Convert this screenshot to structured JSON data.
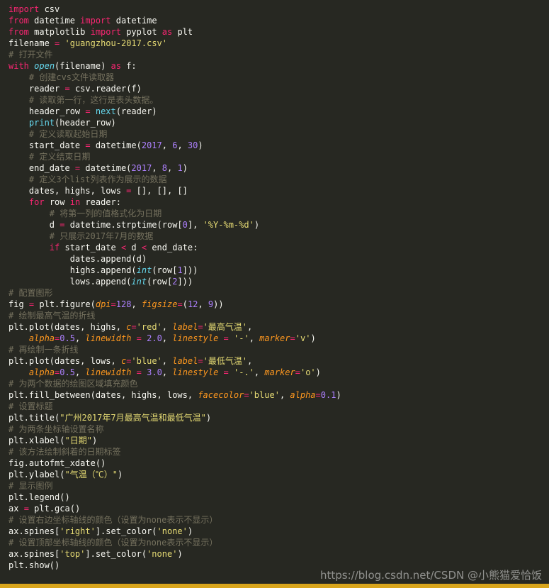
{
  "colors": {
    "background": "#272822",
    "plain": "#f8f8f2",
    "keyword": "#f92672",
    "comment": "#75715e",
    "string": "#e6db74",
    "number": "#ae81ff",
    "builtin": "#66d9ef",
    "param": "#fd971f",
    "bottom_bar": "#d9a51c"
  },
  "watermark": "https://blog.csdn.net/CSDN @小熊猫爱恰饭",
  "code_lines": [
    [
      [
        "kw",
        "import"
      ],
      [
        "tx",
        " csv"
      ]
    ],
    [
      [
        "kw",
        "from"
      ],
      [
        "tx",
        " datetime "
      ],
      [
        "kw",
        "import"
      ],
      [
        "tx",
        " datetime"
      ]
    ],
    [
      [
        "kw",
        "from"
      ],
      [
        "tx",
        " matplotlib "
      ],
      [
        "kw",
        "import"
      ],
      [
        "tx",
        " pyplot "
      ],
      [
        "kw",
        "as"
      ],
      [
        "tx",
        " plt"
      ]
    ],
    [
      [
        "tx",
        "filename "
      ],
      [
        "kw",
        "="
      ],
      [
        "tx",
        " "
      ],
      [
        "st",
        "'guangzhou-2017.csv'"
      ]
    ],
    [
      [
        "cm",
        "# 打开文件"
      ]
    ],
    [
      [
        "kw",
        "with"
      ],
      [
        "tx",
        " "
      ],
      [
        "bi-it",
        "open"
      ],
      [
        "tx",
        "(filename) "
      ],
      [
        "kw",
        "as"
      ],
      [
        "tx",
        " f:"
      ]
    ],
    [
      [
        "tx",
        "    "
      ],
      [
        "cm",
        "# 创建cvs文件读取器"
      ]
    ],
    [
      [
        "tx",
        "    reader "
      ],
      [
        "kw",
        "="
      ],
      [
        "tx",
        " csv.reader(f)"
      ]
    ],
    [
      [
        "tx",
        "    "
      ],
      [
        "cm",
        "# 读取第一行，这行是表头数据。"
      ]
    ],
    [
      [
        "tx",
        "    header_row "
      ],
      [
        "kw",
        "="
      ],
      [
        "tx",
        " "
      ],
      [
        "bi",
        "next"
      ],
      [
        "tx",
        "(reader)"
      ]
    ],
    [
      [
        "tx",
        "    "
      ],
      [
        "bi",
        "print"
      ],
      [
        "tx",
        "(header_row)"
      ]
    ],
    [
      [
        "tx",
        "    "
      ],
      [
        "cm",
        "# 定义读取起始日期"
      ]
    ],
    [
      [
        "tx",
        "    start_date "
      ],
      [
        "kw",
        "="
      ],
      [
        "tx",
        " datetime("
      ],
      [
        "nm",
        "2017"
      ],
      [
        "tx",
        ", "
      ],
      [
        "nm",
        "6"
      ],
      [
        "tx",
        ", "
      ],
      [
        "nm",
        "30"
      ],
      [
        "tx",
        ")"
      ]
    ],
    [
      [
        "tx",
        "    "
      ],
      [
        "cm",
        "# 定义结束日期"
      ]
    ],
    [
      [
        "tx",
        "    end_date "
      ],
      [
        "kw",
        "="
      ],
      [
        "tx",
        " datetime("
      ],
      [
        "nm",
        "2017"
      ],
      [
        "tx",
        ", "
      ],
      [
        "nm",
        "8"
      ],
      [
        "tx",
        ", "
      ],
      [
        "nm",
        "1"
      ],
      [
        "tx",
        ")"
      ]
    ],
    [
      [
        "tx",
        "    "
      ],
      [
        "cm",
        "# 定义3个list列表作为展示的数据"
      ]
    ],
    [
      [
        "tx",
        "    dates, highs, lows "
      ],
      [
        "kw",
        "="
      ],
      [
        "tx",
        " [], [], []"
      ]
    ],
    [
      [
        "tx",
        "    "
      ],
      [
        "kw",
        "for"
      ],
      [
        "tx",
        " row "
      ],
      [
        "kw",
        "in"
      ],
      [
        "tx",
        " reader:"
      ]
    ],
    [
      [
        "tx",
        "        "
      ],
      [
        "cm",
        "# 将第一列的值格式化为日期"
      ]
    ],
    [
      [
        "tx",
        "        d "
      ],
      [
        "kw",
        "="
      ],
      [
        "tx",
        " datetime.strptime(row["
      ],
      [
        "nm",
        "0"
      ],
      [
        "tx",
        "], "
      ],
      [
        "st",
        "'%Y-%m-%d'"
      ],
      [
        "tx",
        ")"
      ]
    ],
    [
      [
        "tx",
        "        "
      ],
      [
        "cm",
        "# 只展示2017年7月的数据"
      ]
    ],
    [
      [
        "tx",
        "        "
      ],
      [
        "kw",
        "if"
      ],
      [
        "tx",
        " start_date "
      ],
      [
        "kw",
        "<"
      ],
      [
        "tx",
        " d "
      ],
      [
        "kw",
        "<"
      ],
      [
        "tx",
        " end_date:"
      ]
    ],
    [
      [
        "tx",
        "            dates.append(d)"
      ]
    ],
    [
      [
        "tx",
        "            highs.append("
      ],
      [
        "bi-it",
        "int"
      ],
      [
        "tx",
        "(row["
      ],
      [
        "nm",
        "1"
      ],
      [
        "tx",
        "]))"
      ]
    ],
    [
      [
        "tx",
        "            lows.append("
      ],
      [
        "bi-it",
        "int"
      ],
      [
        "tx",
        "(row["
      ],
      [
        "nm",
        "2"
      ],
      [
        "tx",
        "]))"
      ]
    ],
    [
      [
        "cm",
        "# 配置图形"
      ]
    ],
    [
      [
        "tx",
        "fig "
      ],
      [
        "kw",
        "="
      ],
      [
        "tx",
        " plt.figure("
      ],
      [
        "pm",
        "dpi"
      ],
      [
        "kw",
        "="
      ],
      [
        "nm",
        "128"
      ],
      [
        "tx",
        ", "
      ],
      [
        "pm",
        "figsize"
      ],
      [
        "kw",
        "="
      ],
      [
        "tx",
        "("
      ],
      [
        "nm",
        "12"
      ],
      [
        "tx",
        ", "
      ],
      [
        "nm",
        "9"
      ],
      [
        "tx",
        "))"
      ]
    ],
    [
      [
        "cm",
        "# 绘制最高气温的折线"
      ]
    ],
    [
      [
        "tx",
        "plt.plot(dates, highs, "
      ],
      [
        "pm",
        "c"
      ],
      [
        "kw",
        "="
      ],
      [
        "st",
        "'red'"
      ],
      [
        "tx",
        ", "
      ],
      [
        "pm",
        "label"
      ],
      [
        "kw",
        "="
      ],
      [
        "st",
        "'最高气温'"
      ],
      [
        "tx",
        ","
      ]
    ],
    [
      [
        "tx",
        "    "
      ],
      [
        "pm",
        "alpha"
      ],
      [
        "kw",
        "="
      ],
      [
        "nm",
        "0.5"
      ],
      [
        "tx",
        ", "
      ],
      [
        "pm",
        "linewidth"
      ],
      [
        "tx",
        " "
      ],
      [
        "kw",
        "="
      ],
      [
        "tx",
        " "
      ],
      [
        "nm",
        "2.0"
      ],
      [
        "tx",
        ", "
      ],
      [
        "pm",
        "linestyle"
      ],
      [
        "tx",
        " "
      ],
      [
        "kw",
        "="
      ],
      [
        "tx",
        " "
      ],
      [
        "st",
        "'-'"
      ],
      [
        "tx",
        ", "
      ],
      [
        "pm",
        "marker"
      ],
      [
        "kw",
        "="
      ],
      [
        "st",
        "'v'"
      ],
      [
        "tx",
        ")"
      ]
    ],
    [
      [
        "cm",
        "# 再绘制一条折线"
      ]
    ],
    [
      [
        "tx",
        "plt.plot(dates, lows, "
      ],
      [
        "pm",
        "c"
      ],
      [
        "kw",
        "="
      ],
      [
        "st",
        "'blue'"
      ],
      [
        "tx",
        ", "
      ],
      [
        "pm",
        "label"
      ],
      [
        "kw",
        "="
      ],
      [
        "st",
        "'最低气温'"
      ],
      [
        "tx",
        ","
      ]
    ],
    [
      [
        "tx",
        "    "
      ],
      [
        "pm",
        "alpha"
      ],
      [
        "kw",
        "="
      ],
      [
        "nm",
        "0.5"
      ],
      [
        "tx",
        ", "
      ],
      [
        "pm",
        "linewidth"
      ],
      [
        "tx",
        " "
      ],
      [
        "kw",
        "="
      ],
      [
        "tx",
        " "
      ],
      [
        "nm",
        "3.0"
      ],
      [
        "tx",
        ", "
      ],
      [
        "pm",
        "linestyle"
      ],
      [
        "tx",
        " "
      ],
      [
        "kw",
        "="
      ],
      [
        "tx",
        " "
      ],
      [
        "st",
        "'-.'"
      ],
      [
        "tx",
        ", "
      ],
      [
        "pm",
        "marker"
      ],
      [
        "kw",
        "="
      ],
      [
        "st",
        "'o'"
      ],
      [
        "tx",
        ")"
      ]
    ],
    [
      [
        "cm",
        "# 为两个数据的绘图区域填充颜色"
      ]
    ],
    [
      [
        "tx",
        "plt.fill_between(dates, highs, lows, "
      ],
      [
        "pm",
        "facecolor"
      ],
      [
        "kw",
        "="
      ],
      [
        "st",
        "'blue'"
      ],
      [
        "tx",
        ", "
      ],
      [
        "pm",
        "alpha"
      ],
      [
        "kw",
        "="
      ],
      [
        "nm",
        "0.1"
      ],
      [
        "tx",
        ")"
      ]
    ],
    [
      [
        "cm",
        "# 设置标题"
      ]
    ],
    [
      [
        "tx",
        "plt.title("
      ],
      [
        "st",
        "\"广州2017年7月最高气温和最低气温\""
      ],
      [
        "tx",
        ")"
      ]
    ],
    [
      [
        "cm",
        "# 为两条坐标轴设置名称"
      ]
    ],
    [
      [
        "tx",
        "plt.xlabel("
      ],
      [
        "st",
        "\"日期\""
      ],
      [
        "tx",
        ")"
      ]
    ],
    [
      [
        "cm",
        "# 该方法绘制斜着的日期标签"
      ]
    ],
    [
      [
        "tx",
        "fig.autofmt_xdate()"
      ]
    ],
    [
      [
        "tx",
        "plt.ylabel("
      ],
      [
        "st",
        "\"气温（℃）\""
      ],
      [
        "tx",
        ")"
      ]
    ],
    [
      [
        "cm",
        "# 显示图例"
      ]
    ],
    [
      [
        "tx",
        "plt.legend()"
      ]
    ],
    [
      [
        "tx",
        "ax "
      ],
      [
        "kw",
        "="
      ],
      [
        "tx",
        " plt.gca()"
      ]
    ],
    [
      [
        "cm",
        "# 设置右边坐标轴线的颜色（设置为none表示不显示）"
      ]
    ],
    [
      [
        "tx",
        "ax.spines["
      ],
      [
        "st",
        "'right'"
      ],
      [
        "tx",
        "].set_color("
      ],
      [
        "st",
        "'none'"
      ],
      [
        "tx",
        ")"
      ]
    ],
    [
      [
        "cm",
        "# 设置顶部坐标轴线的颜色（设置为none表示不显示）"
      ]
    ],
    [
      [
        "tx",
        "ax.spines["
      ],
      [
        "st",
        "'top'"
      ],
      [
        "tx",
        "].set_color("
      ],
      [
        "st",
        "'none'"
      ],
      [
        "tx",
        ")"
      ]
    ],
    [
      [
        "tx",
        "plt.show()"
      ]
    ]
  ]
}
